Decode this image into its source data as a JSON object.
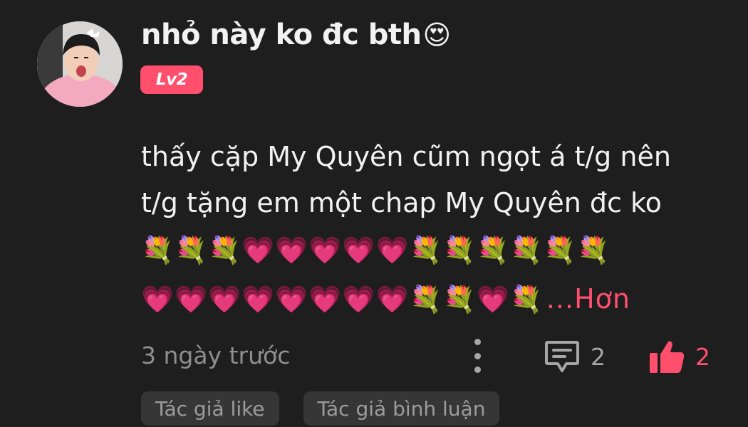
{
  "comment": {
    "username": "nhỏ này ko đc bth",
    "username_emoji": "😍",
    "level_badge": "Lv2",
    "content_lines": [
      "thấy cặp My Quyên cũm ngọt á t/g nên",
      "t/g tặng em một chap My Quyên đc ko"
    ],
    "emoji_line_1": "💐💐💐💗💗💗💗💗💐💐💐💐💐💐",
    "emoji_line_2": "💗💗💗💗💗💗💗💗💐💐💗💐",
    "more_label": "...Hơn",
    "timestamp": "3 ngày trước",
    "reply_count": "2",
    "like_count": "2",
    "icons": {
      "more": "more-vertical-icon",
      "reply": "comment-icon",
      "like": "thumbs-up-icon"
    },
    "colors": {
      "accent": "#ff4f6d",
      "background": "#1e1e1e",
      "chip_background": "#363636"
    }
  },
  "tags": [
    "Tác giả like",
    "Tác giả bình luận"
  ]
}
